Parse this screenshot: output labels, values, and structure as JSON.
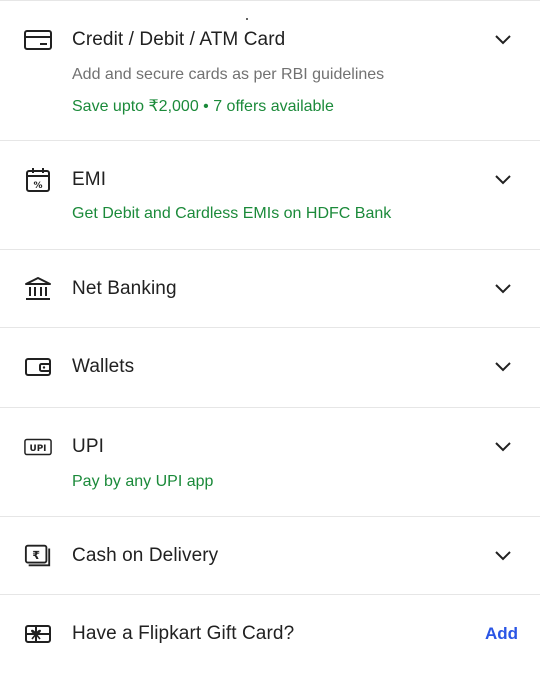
{
  "payment_options": [
    {
      "title": "Credit / Debit / ATM Card",
      "icon": "credit-card-icon",
      "subtitle": "Add and secure cards as per RBI guidelines",
      "offer": "Save upto ₹2,000 • 7 offers available"
    },
    {
      "title": "EMI",
      "icon": "emi-calendar-icon",
      "offer": "Get Debit and Cardless EMIs on HDFC Bank"
    },
    {
      "title": "Net Banking",
      "icon": "bank-icon"
    },
    {
      "title": "Wallets",
      "icon": "wallet-icon"
    },
    {
      "title": "UPI",
      "icon": "upi-icon",
      "icon_text": "UPI",
      "offer": "Pay by any UPI app"
    },
    {
      "title": "Cash on Delivery",
      "icon": "cash-rupee-icon",
      "icon_text": "₹"
    }
  ],
  "gift_card": {
    "title": "Have a Flipkart Gift Card?",
    "icon": "gift-card-icon",
    "action_label": "Add"
  },
  "colors": {
    "title": "#212121",
    "subtitle_gray": "#717171",
    "offer_green": "#1b8a3a",
    "link_blue": "#2a55e5",
    "divider": "#e6e6e6"
  }
}
